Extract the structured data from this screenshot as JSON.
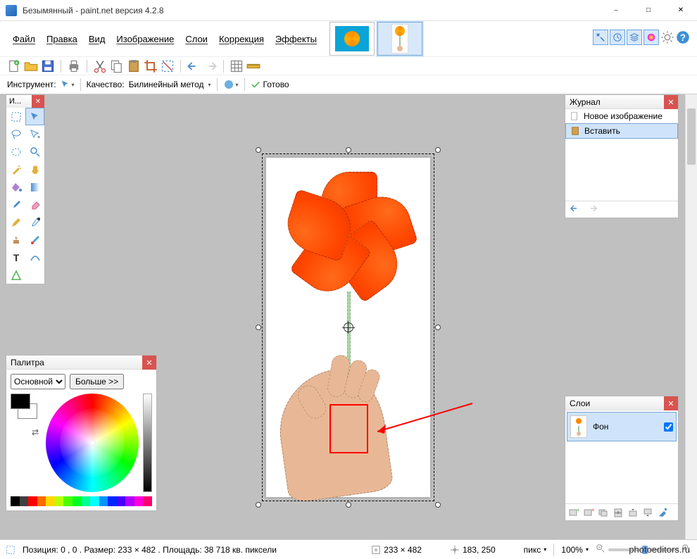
{
  "title": "Безымянный - paint.net версия 4.2.8",
  "menu": {
    "file": "Файл",
    "edit": "Правка",
    "view": "Вид",
    "image": "Изображение",
    "layers": "Слои",
    "adjustments": "Коррекция",
    "effects": "Эффекты"
  },
  "tool_options": {
    "instrument_label": "Инструмент:",
    "quality_label": "Качество:",
    "quality_value": "Билинейный метод",
    "status_ready": "Готово"
  },
  "tools_panel": {
    "title": "И..."
  },
  "history_panel": {
    "title": "Журнал",
    "items": [
      "Новое изображение",
      "Вставить"
    ]
  },
  "layers_panel": {
    "title": "Слои",
    "items": [
      {
        "name": "Фон",
        "visible": true
      }
    ]
  },
  "colors_panel": {
    "title": "Палитра",
    "primary_label": "Основной",
    "more_label": "Больше >>"
  },
  "statusbar": {
    "selection_info": "Позиция: 0 , 0 . Размер: 233  × 482 . Площадь: 38 718 кв. пиксели",
    "canvas_size": "233 × 482",
    "cursor_pos": "183, 250",
    "units": "пикс",
    "zoom": "100%"
  },
  "credit": "photoeditors.ru",
  "palette_strip": [
    "#000",
    "#404040",
    "#ff0000",
    "#ff6a00",
    "#ffd800",
    "#b6ff00",
    "#4cff00",
    "#00ff21",
    "#00ff90",
    "#00ffff",
    "#0094ff",
    "#0026ff",
    "#4800ff",
    "#b200ff",
    "#ff00dc",
    "#ff006e"
  ]
}
